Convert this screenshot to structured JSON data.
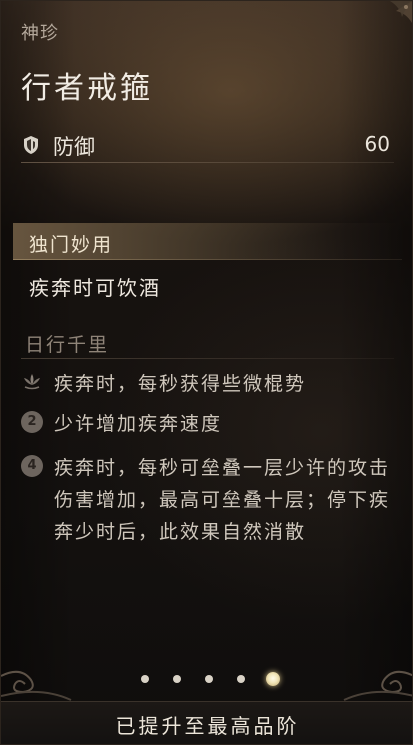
{
  "item": {
    "category": "神珍",
    "name": "行者戒箍"
  },
  "stat": {
    "icon": "shield-icon",
    "label": "防御",
    "value": "60"
  },
  "unique": {
    "header": "独门妙用",
    "effect": "疾奔时可饮酒"
  },
  "set_bonus": {
    "title": "日行千里",
    "entries": [
      {
        "icon": "lotus-icon",
        "text": "疾奔时，每秒获得些微棍势"
      },
      {
        "icon": "number-2-icon",
        "badge": "2",
        "text": "少许增加疾奔速度"
      },
      {
        "icon": "number-4-icon",
        "badge": "4",
        "text": "疾奔时，每秒可垒叠一层少许的攻击伤害增加，最高可垒叠十层；停下疾奔少时后，此效果自然消散"
      }
    ]
  },
  "pagination": {
    "total": 5,
    "active_index": 4
  },
  "footer": {
    "status": "已提升至最高品阶"
  }
}
